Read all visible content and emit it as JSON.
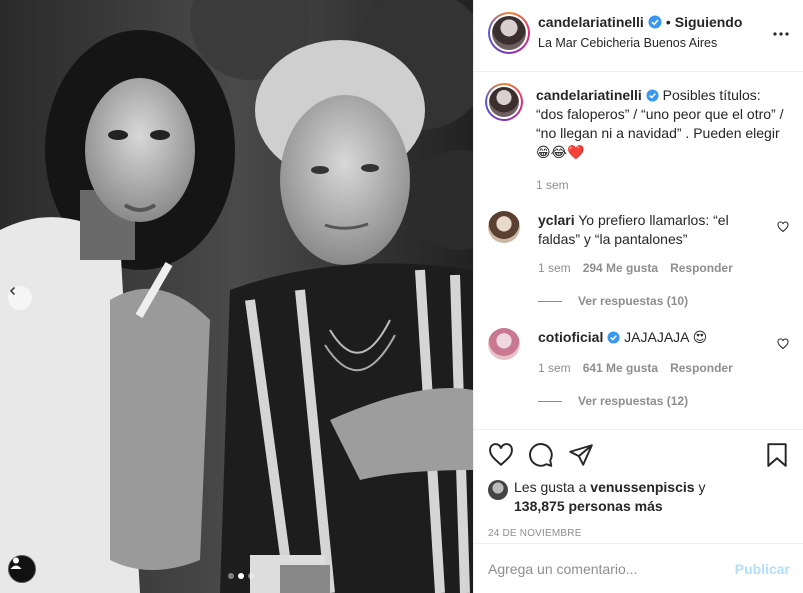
{
  "post": {
    "username": "candelariatinelli",
    "separator": "•",
    "follow_status": "Siguiendo",
    "location": "La Mar Cebicheria Buenos Aires",
    "more_icon": "more-horizontal-icon"
  },
  "caption": {
    "username": "candelariatinelli",
    "text": "Posibles títulos: “dos faloperos” / “uno peor que el otro” / “no llegan ni a navidad” . Pueden elegir 😁😂❤️",
    "time": "1 sem"
  },
  "comments": [
    {
      "username": "yclari",
      "text": "Yo prefiero llamarlos: “el faldas” y “la pantalones”",
      "time": "1 sem",
      "likes": "294 Me gusta",
      "reply_label": "Responder",
      "view_replies": "Ver respuestas (10)"
    },
    {
      "username": "cotioficial",
      "text": "JAJAJAJA 😍",
      "time": "1 sem",
      "likes": "641 Me gusta",
      "reply_label": "Responder",
      "view_replies": "Ver respuestas (12)"
    }
  ],
  "likes": {
    "prefix": "Les gusta a",
    "first_user": "venussenpiscis",
    "connector": "y",
    "others": "138,875 personas más"
  },
  "date": "24 DE NOVIEMBRE",
  "add_comment": {
    "placeholder": "Agrega un comentario...",
    "publish_label": "Publicar"
  },
  "carousel": {
    "total": 3,
    "active": 2
  },
  "colors": {
    "verified": "#3897f0",
    "publish": "#b2dffc",
    "muted": "#8e8e8e",
    "text": "#262626"
  }
}
